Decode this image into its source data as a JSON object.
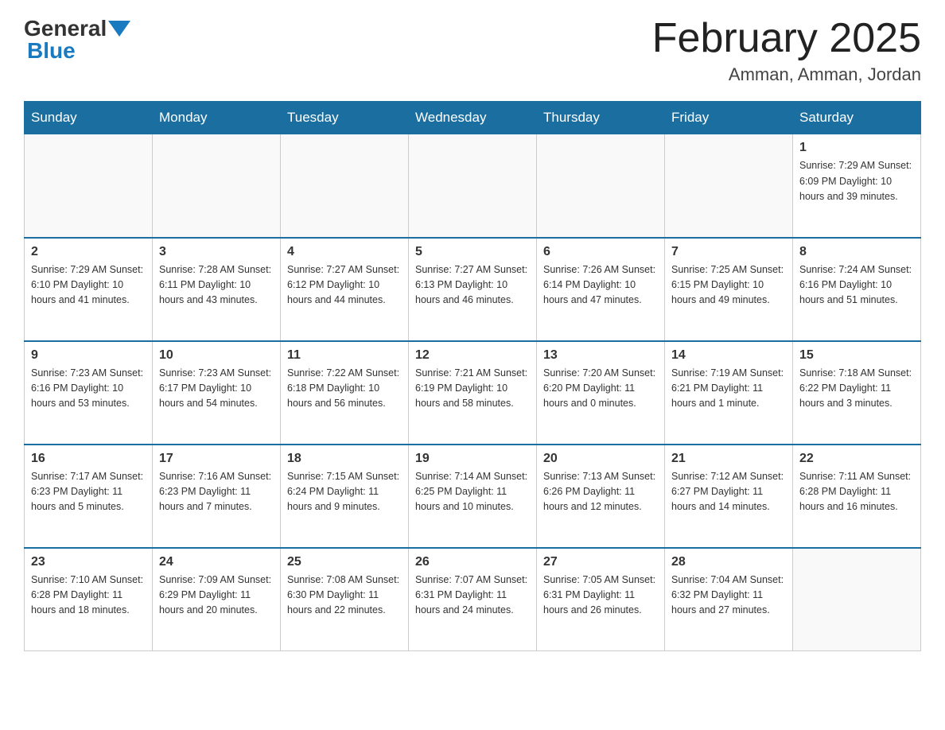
{
  "header": {
    "logo": {
      "general": "General",
      "blue": "Blue"
    },
    "title": "February 2025",
    "location": "Amman, Amman, Jordan"
  },
  "days_of_week": [
    "Sunday",
    "Monday",
    "Tuesday",
    "Wednesday",
    "Thursday",
    "Friday",
    "Saturday"
  ],
  "weeks": [
    [
      {
        "day": "",
        "info": ""
      },
      {
        "day": "",
        "info": ""
      },
      {
        "day": "",
        "info": ""
      },
      {
        "day": "",
        "info": ""
      },
      {
        "day": "",
        "info": ""
      },
      {
        "day": "",
        "info": ""
      },
      {
        "day": "1",
        "info": "Sunrise: 7:29 AM\nSunset: 6:09 PM\nDaylight: 10 hours\nand 39 minutes."
      }
    ],
    [
      {
        "day": "2",
        "info": "Sunrise: 7:29 AM\nSunset: 6:10 PM\nDaylight: 10 hours\nand 41 minutes."
      },
      {
        "day": "3",
        "info": "Sunrise: 7:28 AM\nSunset: 6:11 PM\nDaylight: 10 hours\nand 43 minutes."
      },
      {
        "day": "4",
        "info": "Sunrise: 7:27 AM\nSunset: 6:12 PM\nDaylight: 10 hours\nand 44 minutes."
      },
      {
        "day": "5",
        "info": "Sunrise: 7:27 AM\nSunset: 6:13 PM\nDaylight: 10 hours\nand 46 minutes."
      },
      {
        "day": "6",
        "info": "Sunrise: 7:26 AM\nSunset: 6:14 PM\nDaylight: 10 hours\nand 47 minutes."
      },
      {
        "day": "7",
        "info": "Sunrise: 7:25 AM\nSunset: 6:15 PM\nDaylight: 10 hours\nand 49 minutes."
      },
      {
        "day": "8",
        "info": "Sunrise: 7:24 AM\nSunset: 6:16 PM\nDaylight: 10 hours\nand 51 minutes."
      }
    ],
    [
      {
        "day": "9",
        "info": "Sunrise: 7:23 AM\nSunset: 6:16 PM\nDaylight: 10 hours\nand 53 minutes."
      },
      {
        "day": "10",
        "info": "Sunrise: 7:23 AM\nSunset: 6:17 PM\nDaylight: 10 hours\nand 54 minutes."
      },
      {
        "day": "11",
        "info": "Sunrise: 7:22 AM\nSunset: 6:18 PM\nDaylight: 10 hours\nand 56 minutes."
      },
      {
        "day": "12",
        "info": "Sunrise: 7:21 AM\nSunset: 6:19 PM\nDaylight: 10 hours\nand 58 minutes."
      },
      {
        "day": "13",
        "info": "Sunrise: 7:20 AM\nSunset: 6:20 PM\nDaylight: 11 hours\nand 0 minutes."
      },
      {
        "day": "14",
        "info": "Sunrise: 7:19 AM\nSunset: 6:21 PM\nDaylight: 11 hours\nand 1 minute."
      },
      {
        "day": "15",
        "info": "Sunrise: 7:18 AM\nSunset: 6:22 PM\nDaylight: 11 hours\nand 3 minutes."
      }
    ],
    [
      {
        "day": "16",
        "info": "Sunrise: 7:17 AM\nSunset: 6:23 PM\nDaylight: 11 hours\nand 5 minutes."
      },
      {
        "day": "17",
        "info": "Sunrise: 7:16 AM\nSunset: 6:23 PM\nDaylight: 11 hours\nand 7 minutes."
      },
      {
        "day": "18",
        "info": "Sunrise: 7:15 AM\nSunset: 6:24 PM\nDaylight: 11 hours\nand 9 minutes."
      },
      {
        "day": "19",
        "info": "Sunrise: 7:14 AM\nSunset: 6:25 PM\nDaylight: 11 hours\nand 10 minutes."
      },
      {
        "day": "20",
        "info": "Sunrise: 7:13 AM\nSunset: 6:26 PM\nDaylight: 11 hours\nand 12 minutes."
      },
      {
        "day": "21",
        "info": "Sunrise: 7:12 AM\nSunset: 6:27 PM\nDaylight: 11 hours\nand 14 minutes."
      },
      {
        "day": "22",
        "info": "Sunrise: 7:11 AM\nSunset: 6:28 PM\nDaylight: 11 hours\nand 16 minutes."
      }
    ],
    [
      {
        "day": "23",
        "info": "Sunrise: 7:10 AM\nSunset: 6:28 PM\nDaylight: 11 hours\nand 18 minutes."
      },
      {
        "day": "24",
        "info": "Sunrise: 7:09 AM\nSunset: 6:29 PM\nDaylight: 11 hours\nand 20 minutes."
      },
      {
        "day": "25",
        "info": "Sunrise: 7:08 AM\nSunset: 6:30 PM\nDaylight: 11 hours\nand 22 minutes."
      },
      {
        "day": "26",
        "info": "Sunrise: 7:07 AM\nSunset: 6:31 PM\nDaylight: 11 hours\nand 24 minutes."
      },
      {
        "day": "27",
        "info": "Sunrise: 7:05 AM\nSunset: 6:31 PM\nDaylight: 11 hours\nand 26 minutes."
      },
      {
        "day": "28",
        "info": "Sunrise: 7:04 AM\nSunset: 6:32 PM\nDaylight: 11 hours\nand 27 minutes."
      },
      {
        "day": "",
        "info": ""
      }
    ]
  ]
}
